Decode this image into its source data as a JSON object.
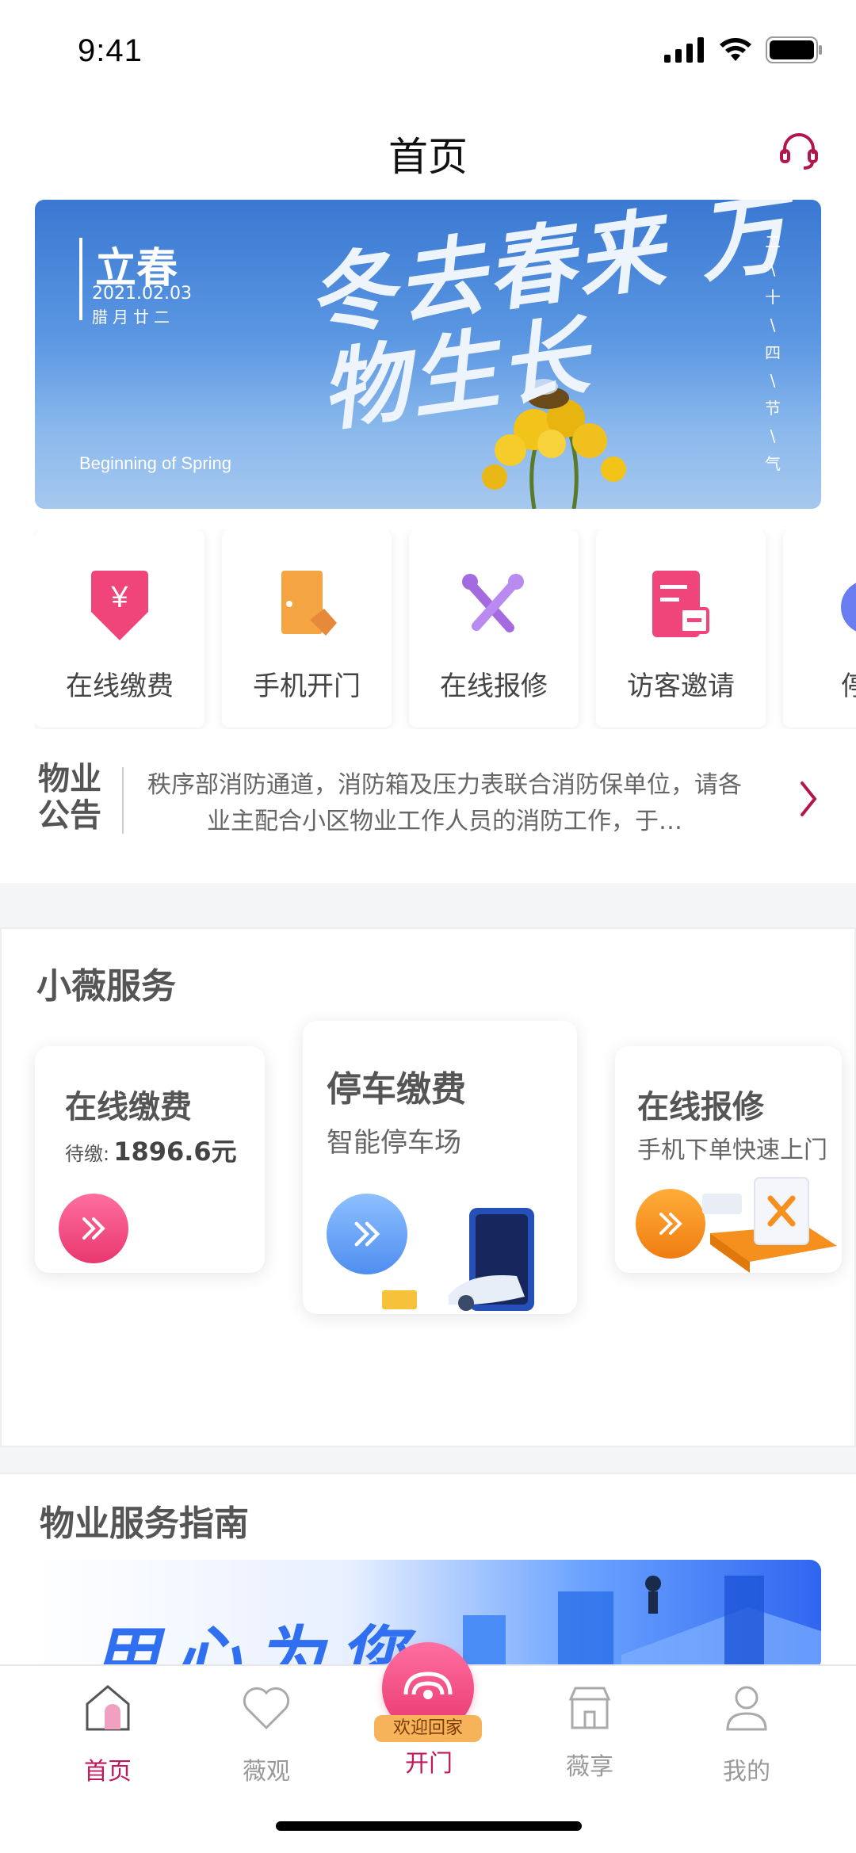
{
  "status_bar": {
    "time": "9:41"
  },
  "header": {
    "title": "首页",
    "support_icon": "headset-icon"
  },
  "banner": {
    "solar_term": "立春",
    "date": "2021.02.03",
    "lunar_date": "腊月廿二",
    "english": "Beginning of Spring",
    "calligraphy": "冬去春来 万物生长",
    "vertical_chars": [
      "二",
      "十",
      "四",
      "节",
      "气"
    ]
  },
  "quick_actions": [
    {
      "label": "在线缴费",
      "icon": "payment-icon",
      "color": "#f0457a"
    },
    {
      "label": "手机开门",
      "icon": "door-phone-icon",
      "color": "#f5a442"
    },
    {
      "label": "在线报修",
      "icon": "repair-tools-icon",
      "color": "#a46ae0"
    },
    {
      "label": "访客邀请",
      "icon": "visitor-invite-icon",
      "color": "#f0457a"
    },
    {
      "label": "停车",
      "icon": "parking-icon",
      "color": "#6a7df0"
    }
  ],
  "notice": {
    "tag": "物业公告",
    "text": "秩序部消防通道，消防箱及压力表联合消防保单位，请各业主配合小区物业工作人员的消防工作，于…"
  },
  "services": {
    "title": "小薇服务",
    "cards": [
      {
        "title": "在线缴费",
        "subtitle_label": "待缴:",
        "subtitle_value": "1896.6元",
        "button_color": "#f0457a"
      },
      {
        "title": "停车缴费",
        "subtitle": "智能停车场",
        "button_color": "#5b9cf5"
      },
      {
        "title": "在线报修",
        "subtitle": "手机下单快速上门",
        "button_color": "#f5901e"
      }
    ]
  },
  "guide": {
    "title": "物业服务指南",
    "banner_text": "用心为您"
  },
  "tab_bar": {
    "items": [
      {
        "label": "首页",
        "icon": "home-icon",
        "active": true
      },
      {
        "label": "薇观",
        "icon": "heart-icon",
        "active": false
      },
      {
        "label": "开门",
        "icon": "logo-icon",
        "badge": "欢迎回家",
        "active": false
      },
      {
        "label": "薇享",
        "icon": "shop-icon",
        "active": false
      },
      {
        "label": "我的",
        "icon": "user-icon",
        "active": false
      }
    ]
  },
  "colors": {
    "accent": "#c2185b",
    "pink": "#f0457a",
    "blue": "#5b9cf5",
    "orange": "#f5901e"
  }
}
